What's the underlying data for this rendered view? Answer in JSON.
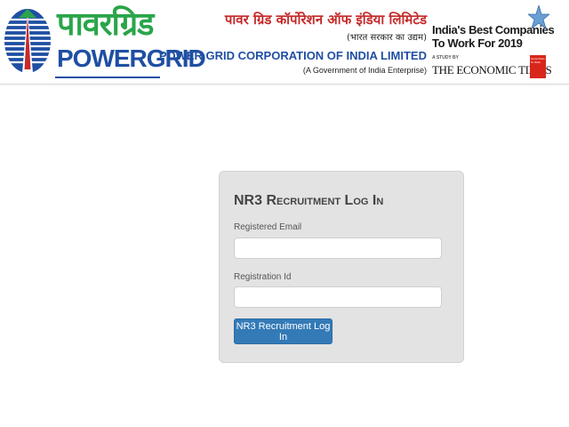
{
  "header": {
    "logo_hindi": "पावरग्रिड",
    "logo_english": "POWERGRID",
    "company_hindi": "पावर ग्रिड कॉर्पोरेशन ऑफ इंडिया लिमिटेड",
    "company_hindi_sub": "(भारत सरकार का उद्यम)",
    "company_english": "POWER GRID CORPORATION OF INDIA LIMITED",
    "company_english_sub": "(A Government of India Enterprise)",
    "award": {
      "line1": "India's Best Companies",
      "line2": "To Work For 2019",
      "study": "A STUDY BY",
      "publisher": "THE ECONOMIC TIMES",
      "badge": "Great Place To Work"
    }
  },
  "login": {
    "title": "NR3 Recruitment Log In",
    "email_label": "Registered Email",
    "email_value": "",
    "regid_label": "Registration Id",
    "regid_value": "",
    "submit_label": "NR3 Recruitment Log In"
  },
  "colors": {
    "brand_green": "#2aa54a",
    "brand_blue": "#1f4fa3",
    "hindi_red": "#c52a2a",
    "button_blue": "#337ab7",
    "card_bg": "#e3e3e3"
  }
}
